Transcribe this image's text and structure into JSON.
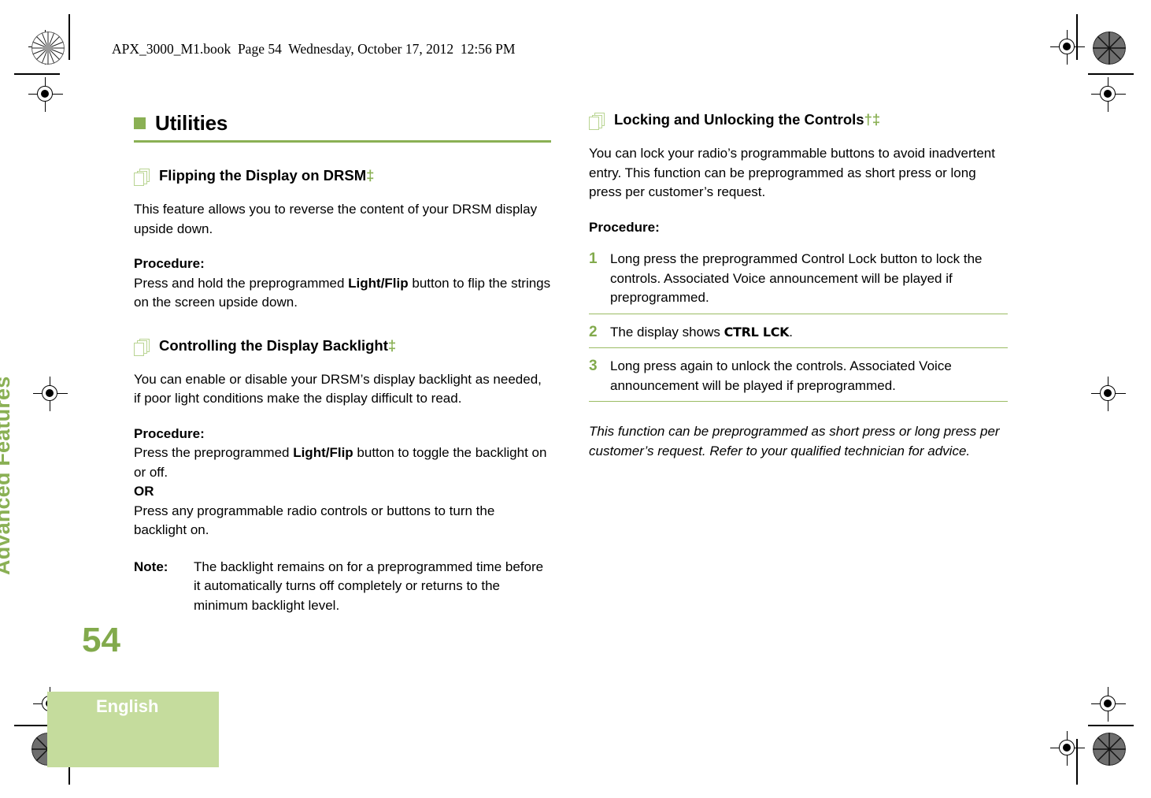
{
  "header": {
    "file_line": "APX_3000_M1.book  Page 54  Wednesday, October 17, 2012  12:56 PM"
  },
  "side_tab": {
    "label": "Advanced Features"
  },
  "footer": {
    "page_number": "54",
    "language": "English"
  },
  "colors": {
    "accent_green": "#8ab054",
    "footer_green": "#c5dc9d",
    "icon_green": "#b9d492"
  },
  "left_column": {
    "chapter_title": "Utilities",
    "sections": [
      {
        "title": "Flipping the Display on DRSM",
        "markers": "‡",
        "intro": "This feature allows you to reverse the content of your DRSM display upside down.",
        "procedure_label": "Procedure:",
        "procedure_parts": [
          {
            "text": "Press and hold the preprogrammed "
          },
          {
            "text": "Light/Flip",
            "bold": true
          },
          {
            "text": " button to flip the strings on the screen upside down."
          }
        ]
      },
      {
        "title": "Controlling the Display Backlight",
        "markers": "‡",
        "intro": "You can enable or disable your DRSM’s display backlight as needed, if poor light conditions make the display difficult to read.",
        "procedure_label": "Procedure:",
        "procedure_parts": [
          {
            "text": "Press the preprogrammed "
          },
          {
            "text": "Light/Flip",
            "bold": true
          },
          {
            "text": " button to toggle the backlight on or off."
          }
        ],
        "or_label": "OR",
        "alt_text": "Press any programmable radio controls or buttons to turn the backlight on.",
        "note_label": "Note:",
        "note_text": "The backlight remains on for a preprogrammed time before it automatically turns off completely or returns to the minimum backlight level."
      }
    ]
  },
  "right_column": {
    "section": {
      "title": "Locking and Unlocking the Controls",
      "markers": "†‡",
      "intro": "You can lock your radio’s programmable buttons to avoid inadvertent entry. This function can be preprogrammed as short press or long press per customer’s request.",
      "procedure_label": "Procedure:",
      "steps": [
        {
          "number": "1",
          "parts": [
            {
              "text": "Long press the preprogrammed Control Lock button to lock the controls. Associated Voice announcement will be played if preprogrammed."
            }
          ]
        },
        {
          "number": "2",
          "parts": [
            {
              "text": "The display shows "
            },
            {
              "text": "CTRL LCK",
              "display": true
            },
            {
              "text": "."
            }
          ]
        },
        {
          "number": "3",
          "parts": [
            {
              "text": "Long press again to unlock the controls. Associated Voice announcement will be played if preprogrammed."
            }
          ]
        }
      ],
      "closing_note": "This function can be preprogrammed as short press or long press per customer’s request. Refer to your qualified technician for advice."
    }
  }
}
